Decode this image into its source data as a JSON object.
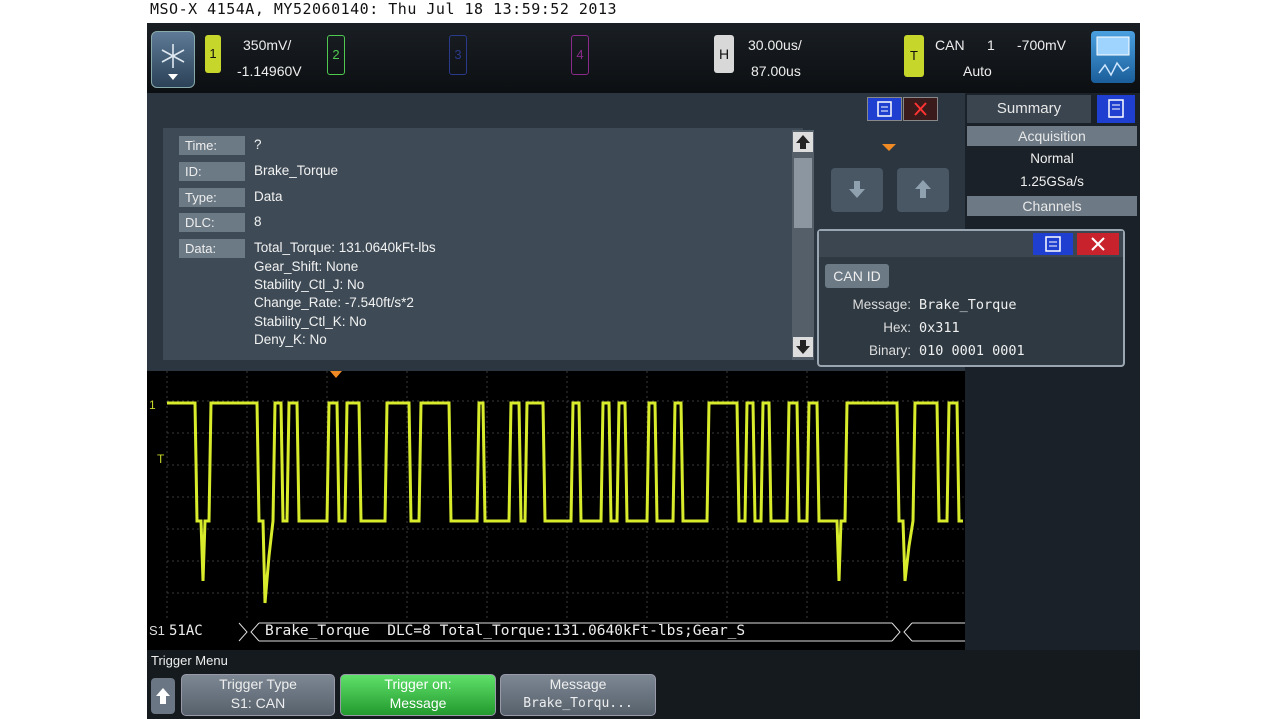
{
  "header": "MSO-X 4154A, MY52060140: Thu Jul 18 13:59:52 2013",
  "topbar": {
    "ch1_label": "1",
    "ch1_scale": "350mV/",
    "ch1_offset": "-1.14960V",
    "ch2_label": "2",
    "ch3_label": "3",
    "ch4_label": "4",
    "h_label": "H",
    "h_scale": "30.00us/",
    "h_delay": "87.00us",
    "t_label": "T",
    "trig_type": "CAN",
    "trig_src": "1",
    "trig_level": "-700mV",
    "trig_mode": "Auto"
  },
  "decode_panel": {
    "fields": [
      {
        "label": "Time:",
        "value": "?"
      },
      {
        "label": "ID:",
        "value": "Brake_Torque"
      },
      {
        "label": "Type:",
        "value": "Data"
      },
      {
        "label": "DLC:",
        "value": "8"
      },
      {
        "label": "Data:",
        "value": "Total_Torque: 131.0640kFt-lbs"
      }
    ],
    "data_lines": [
      "Gear_Shift: None",
      "Stability_Ctl_J: No",
      "Change_Rate: -7.540ft/s*2",
      "Stability_Ctl_K: No",
      "Deny_K: No"
    ]
  },
  "summary": {
    "tab_label": "Summary",
    "acquisition_header": "Acquisition",
    "acq_mode": "Normal",
    "sample_rate": "1.25GSa/s",
    "channels_header": "Channels"
  },
  "popup": {
    "can_id_button": "CAN ID",
    "message_label": "Message:",
    "message_value": "Brake_Torque",
    "hex_label": "Hex:",
    "hex_value": "0x311",
    "binary_label": "Binary:",
    "binary_value": "010 0001 0001"
  },
  "decode_line": {
    "bus_label": "S1",
    "id_field": "51AC",
    "frame_text": "Brake_Torque  DLC=8 Total_Torque:131.0640kFt-lbs;Gear_S"
  },
  "trigger_menu": {
    "title": "Trigger Menu",
    "softkeys": [
      {
        "line1": "Trigger Type",
        "line2": "S1: CAN"
      },
      {
        "line1": "Trigger on:",
        "line2": "Message"
      },
      {
        "line1": "Message",
        "line2": "Brake_Torqu..."
      }
    ]
  },
  "colors": {
    "ch1": "#c6d62a",
    "ch2": "#4fc94f",
    "ch3": "#2a3a8a",
    "ch4": "#8a2a8a",
    "close_red": "#c8232c",
    "menu_blue": "#1f3fd0"
  }
}
